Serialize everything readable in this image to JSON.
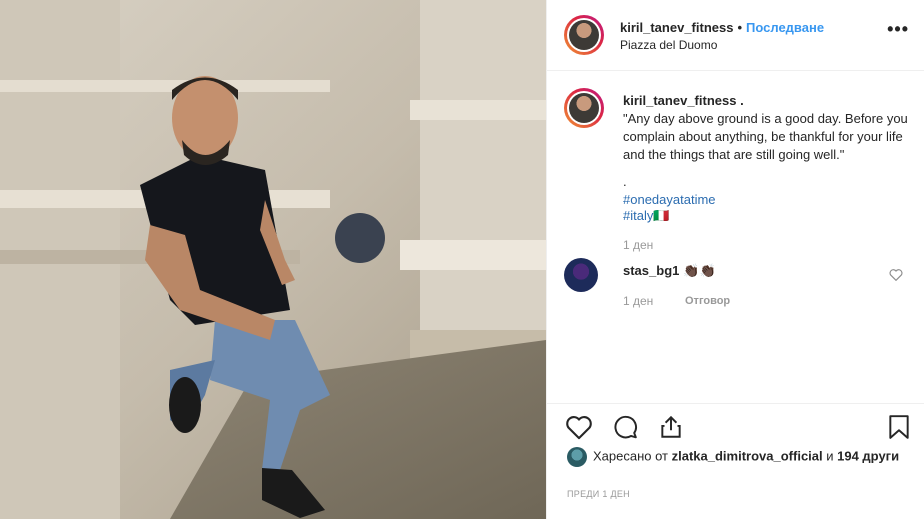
{
  "header": {
    "username": "kiril_tanev_fitness",
    "dot": "•",
    "follow_label": "Последване",
    "location": "Piazza del Duomo",
    "more_label": "..."
  },
  "caption": {
    "username": "kiril_tanev_fitness",
    "username_suffix": " .",
    "text": "\"Any day above ground is a good day. Before you complain about anything, be thankful for your life and the things that are still going well.\"",
    "separator": ".",
    "hashtags": [
      "#onedayatatime",
      "#italy🇮🇹"
    ],
    "time": "1 ден"
  },
  "comments": [
    {
      "username": "stas_bg1",
      "text": "👏🏿👏🏿",
      "time": "1 ден",
      "reply_label": "Отговор"
    }
  ],
  "actions": {
    "icons": [
      "heart-icon",
      "comment-icon",
      "share-icon",
      "bookmark-icon"
    ]
  },
  "likes": {
    "prefix": "Харесано от ",
    "liked_by": "zlatka_dimitrova_official",
    "middle": " и ",
    "others": "194 други"
  },
  "post_time": "ПРЕДИ 1 ДЕН"
}
